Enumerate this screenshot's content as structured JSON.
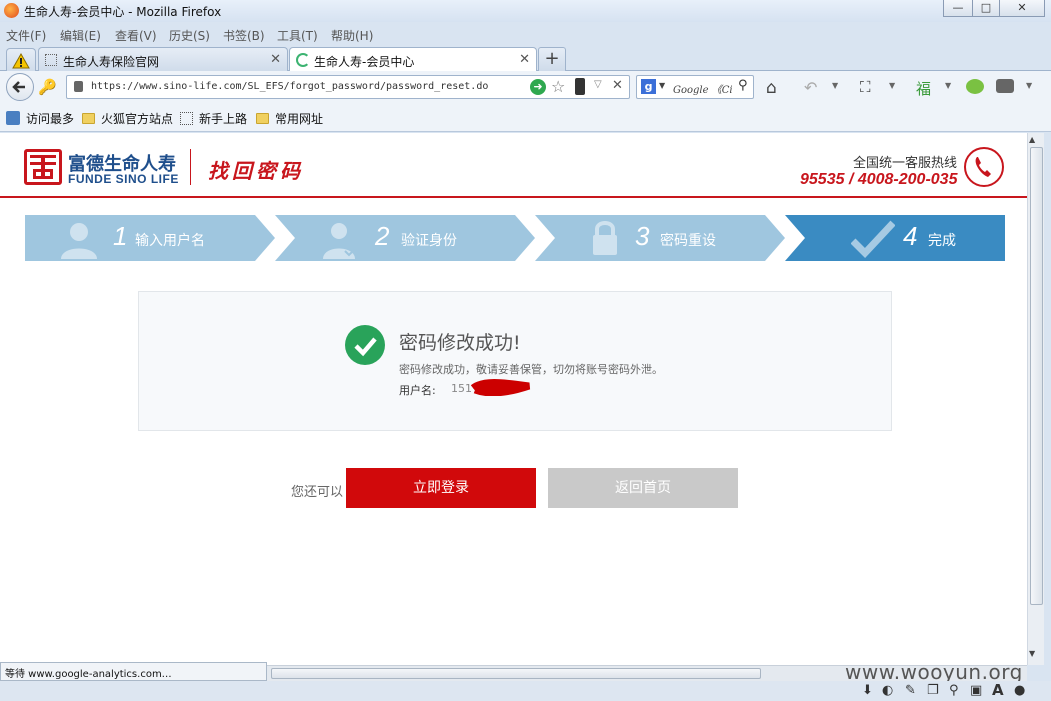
{
  "window": {
    "title": "生命人寿-会员中心 - Mozilla Firefox",
    "minimize": "—",
    "restore": "□",
    "close": "✕"
  },
  "menu": [
    "文件(F)",
    "编辑(E)",
    "查看(V)",
    "历史(S)",
    "书签(B)",
    "工具(T)",
    "帮助(H)"
  ],
  "tabs": [
    {
      "label": "生命人寿保险官网"
    },
    {
      "label": "生命人寿-会员中心"
    }
  ],
  "new_tab": "+",
  "address": {
    "url": "https://www.sino-life.com/SL_EFS/forgot_password/password_reset.do"
  },
  "search": {
    "placeholder": "Google 《Ci"
  },
  "bookmarks": [
    "访问最多",
    "火狐官方站点",
    "新手上路",
    "常用网址"
  ],
  "page": {
    "brand_cn": "富德生命人寿",
    "brand_en": "FUNDE SINO LIFE",
    "section_title": "找回密码",
    "hotline_label": "全国统一客服热线",
    "hotline_numbers": "95535 / 4008-200-035",
    "steps": [
      {
        "num": "1",
        "label": "输入用户名",
        "active": false
      },
      {
        "num": "2",
        "label": "验证身份",
        "active": false
      },
      {
        "num": "3",
        "label": "密码重设",
        "active": false
      },
      {
        "num": "4",
        "label": "完成",
        "active": true
      }
    ],
    "success_title": "密码修改成功!",
    "success_message": "密码修改成功，敬请妥善保管，切勿将账号密码外泄。",
    "username_label": "用户名:",
    "username_value": "151",
    "prompt": "您还可以",
    "login_button": "立即登录",
    "home_button": "返回首页"
  },
  "status": {
    "text": "等待 www.google-analytics.com…",
    "watermark": "www.wooyun.org"
  },
  "colors": {
    "brand_red": "#c8161d",
    "step_inactive": "#9fc6df",
    "step_active": "#3a8bc2",
    "success_green": "#29a35a",
    "button_red": "#d1090b",
    "button_gray": "#c9c9c9"
  }
}
